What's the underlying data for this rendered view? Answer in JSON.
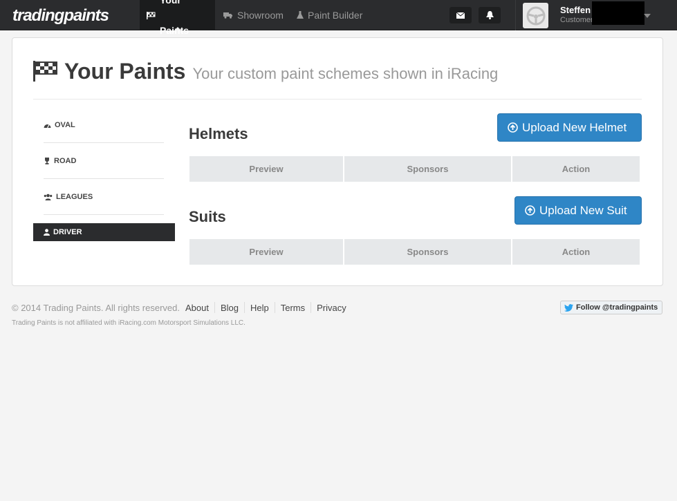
{
  "nav": {
    "logo": "tradingpaints",
    "items": [
      {
        "label": "Your Paints",
        "icon": "flag-icon",
        "active": true
      },
      {
        "label": "Showroom",
        "icon": "truck-icon",
        "active": false
      },
      {
        "label": "Paint Builder",
        "icon": "flask-icon",
        "active": false
      }
    ],
    "user": {
      "name": "Steffen",
      "role": "Customer"
    }
  },
  "page": {
    "title": "Your Paints",
    "subtitle": "Your custom paint schemes shown in iRacing"
  },
  "sidebar": {
    "items": [
      {
        "label": "OVAL",
        "icon": "tachometer-icon"
      },
      {
        "label": "ROAD",
        "icon": "trophy-icon"
      },
      {
        "label": "LEAGUES",
        "icon": "group-icon"
      },
      {
        "label": "DRIVER",
        "icon": "user-icon",
        "active": true
      }
    ]
  },
  "sections": {
    "helmets": {
      "title": "Helmets",
      "button": "Upload New Helmet",
      "columns": [
        "Preview",
        "Sponsors",
        "Action"
      ]
    },
    "suits": {
      "title": "Suits",
      "button": "Upload New Suit",
      "columns": [
        "Preview",
        "Sponsors",
        "Action"
      ]
    }
  },
  "footer": {
    "copyright": "© 2014 Trading Paints. All rights reserved.",
    "links": [
      "About",
      "Blog",
      "Help",
      "Terms",
      "Privacy"
    ],
    "note": "Trading Paints is not affiliated with iRacing.com Motorsport Simulations LLC.",
    "twitter": "Follow @tradingpaints"
  },
  "colors": {
    "topbar": "#2b2c2e",
    "primary_button": "#2f86c6",
    "table_header": "#e6e8ea"
  }
}
